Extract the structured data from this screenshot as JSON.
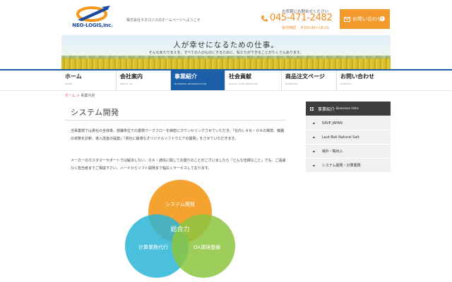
{
  "header": {
    "logo_text": "NEO-LOGIS,Inc.",
    "welcome": "株式会社ネオロジスのホームページへようこそ",
    "contact_lead": "お気軽にお問合せください",
    "phone": "045-471-2482",
    "hours_label": "受付時間",
    "hours": "平日9:00〜18:00",
    "inquiry_button": "お問い合わせ",
    "accent_color": "#f39a2d"
  },
  "hero": {
    "title": "人が幸せになるための仕事。",
    "subtitle": "そんなあたりまえを、すべての人のものにするために、私たちができることがたくさんあります。"
  },
  "nav": {
    "items": [
      {
        "label": "ホーム",
        "en": "HOME"
      },
      {
        "label": "会社案内",
        "en": "ABOUT US"
      },
      {
        "label": "事業紹介",
        "en": "BUSINESS INTRODUCTION"
      },
      {
        "label": "社会貢献",
        "en": "SOCIAL CONTRIBUTION"
      },
      {
        "label": "商品注文ページ",
        "en": "SHOPPING"
      },
      {
        "label": "お問い合わせ",
        "en": "CONTACT"
      }
    ],
    "active_index": 2,
    "active_color": "#1b5fa9"
  },
  "breadcrumb": {
    "home": "ホーム",
    "separator": " > ",
    "current": "事業内容"
  },
  "main": {
    "title": "システム開発",
    "paragraph1": "当事業部では貴社の全体像、部課単位での業務ワークフローを綿密にカウンセリングさせていただき、「社内ＬＡＮ・ＯＡの環境、機器の状態を診断、導入改善の提案」「貴社に最適なオリジナルソフトウエアの開発」をさせていただきます。",
    "paragraph2": "メーカーのカスタマーサポートでは解決しない、ＯＡ・通信に関してお困りのことがございましたら「どんな伍細なこと」でも、ご遠慮なく担当者までご相談下さい。ハードからソフト開発まで幅広くサービスしております。",
    "venn": {
      "top": "システム開発",
      "left": "計算業務代行",
      "right": "OA環境整備",
      "center": "総合力",
      "colors": {
        "top": "#f39a1e",
        "left": "#2bb5d6",
        "right": "#8cc63f"
      }
    }
  },
  "sidebar": {
    "heading": "事業紹介",
    "heading_en": "Business Intro",
    "items": [
      "SAVE JAPAN",
      "Laut Bali Natural Salt",
      "海外・輸出入",
      "システム開発・計算業務"
    ]
  }
}
